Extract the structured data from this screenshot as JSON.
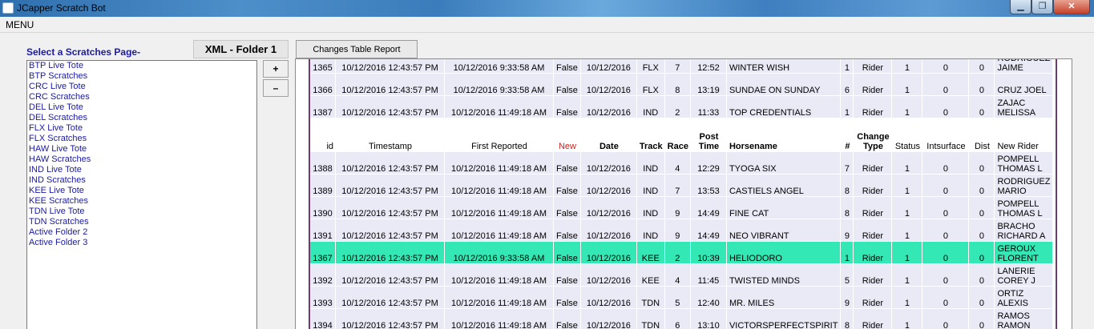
{
  "window": {
    "title": "JCapper Scratch Bot"
  },
  "menu": {
    "label": "MENU"
  },
  "sidebar": {
    "header": "Select a Scratches Page-",
    "folder_label": "XML - Folder 1",
    "items": [
      "BTP Live Tote",
      "BTP Scratches",
      "CRC Live Tote",
      "CRC Scratches",
      "DEL Live Tote",
      "DEL Scratches",
      "FLX Live Tote",
      "FLX Scratches",
      "HAW Live Tote",
      "HAW Scratches",
      "IND Live Tote",
      "IND Scratches",
      "KEE Live Tote",
      "KEE Scratches",
      "TDN Live Tote",
      "TDN Scratches",
      "Active Folder 2",
      "Active Folder 3"
    ],
    "plus_label": "+",
    "minus_label": "–"
  },
  "report_button": "Changes Table Report",
  "grid": {
    "columns": {
      "id": "id",
      "timestamp": "Timestamp",
      "first_reported": "First Reported",
      "new": "New",
      "date": "Date",
      "track": "Track",
      "race": "Race",
      "post_time": "Post Time",
      "horsename": "Horsename",
      "num": "#",
      "change_type": "Change Type",
      "status": "Status",
      "intsurface": "Intsurface",
      "dist": "Dist",
      "new_rider": "New Rider"
    },
    "top_rows": [
      [
        "1365",
        "10/12/2016 12:43:57 PM",
        "10/12/2016 9:33:58 AM",
        "False",
        "10/12/2016",
        "FLX",
        "7",
        "12:52",
        "WINTER WISH",
        "1",
        "Rider",
        "1",
        "0",
        "0",
        "RODRIGUEZ JAIME"
      ],
      [
        "1366",
        "10/12/2016 12:43:57 PM",
        "10/12/2016 9:33:58 AM",
        "False",
        "10/12/2016",
        "FLX",
        "8",
        "13:19",
        "SUNDAE ON SUNDAY",
        "6",
        "Rider",
        "1",
        "0",
        "0",
        "CRUZ JOEL"
      ],
      [
        "1387",
        "10/12/2016 12:43:57 PM",
        "10/12/2016 11:49:18 AM",
        "False",
        "10/12/2016",
        "IND",
        "2",
        "11:33",
        "TOP CREDENTIALS",
        "1",
        "Rider",
        "1",
        "0",
        "0",
        "ZAJAC MELISSA"
      ]
    ],
    "rows": [
      [
        "1388",
        "10/12/2016 12:43:57 PM",
        "10/12/2016 11:49:18 AM",
        "False",
        "10/12/2016",
        "IND",
        "4",
        "12:29",
        "TYOGA SIX",
        "7",
        "Rider",
        "1",
        "0",
        "0",
        "POMPELL THOMAS L"
      ],
      [
        "1389",
        "10/12/2016 12:43:57 PM",
        "10/12/2016 11:49:18 AM",
        "False",
        "10/12/2016",
        "IND",
        "7",
        "13:53",
        "CASTIELS ANGEL",
        "8",
        "Rider",
        "1",
        "0",
        "0",
        "RODRIGUEZ MARIO"
      ],
      [
        "1390",
        "10/12/2016 12:43:57 PM",
        "10/12/2016 11:49:18 AM",
        "False",
        "10/12/2016",
        "IND",
        "9",
        "14:49",
        "FINE CAT",
        "8",
        "Rider",
        "1",
        "0",
        "0",
        "POMPELL THOMAS L"
      ],
      [
        "1391",
        "10/12/2016 12:43:57 PM",
        "10/12/2016 11:49:18 AM",
        "False",
        "10/12/2016",
        "IND",
        "9",
        "14:49",
        "NEO VIBRANT",
        "9",
        "Rider",
        "1",
        "0",
        "0",
        "BRACHO RICHARD A"
      ],
      [
        "1367",
        "10/12/2016 12:43:57 PM",
        "10/12/2016 9:33:58 AM",
        "False",
        "10/12/2016",
        "KEE",
        "2",
        "10:39",
        "HELIODORO",
        "1",
        "Rider",
        "1",
        "0",
        "0",
        "GEROUX FLORENT"
      ],
      [
        "1392",
        "10/12/2016 12:43:57 PM",
        "10/12/2016 11:49:18 AM",
        "False",
        "10/12/2016",
        "KEE",
        "4",
        "11:45",
        "TWISTED MINDS",
        "5",
        "Rider",
        "1",
        "0",
        "0",
        "LANERIE COREY J"
      ],
      [
        "1393",
        "10/12/2016 12:43:57 PM",
        "10/12/2016 11:49:18 AM",
        "False",
        "10/12/2016",
        "TDN",
        "5",
        "12:40",
        "MR. MILES",
        "9",
        "Rider",
        "1",
        "0",
        "0",
        "ORTIZ ALEXIS"
      ],
      [
        "1394",
        "10/12/2016 12:43:57 PM",
        "10/12/2016 11:49:18 AM",
        "False",
        "10/12/2016",
        "TDN",
        "6",
        "13:10",
        "VICTORSPERFECTSPIRIT",
        "8",
        "Rider",
        "1",
        "0",
        "0",
        "RAMOS RAMON"
      ]
    ],
    "selected_row_id": "1367",
    "colors": {
      "row_bg": "#eaeaf7",
      "selected_bg": "#33e8b4",
      "new_header": "#d21b1b"
    }
  }
}
